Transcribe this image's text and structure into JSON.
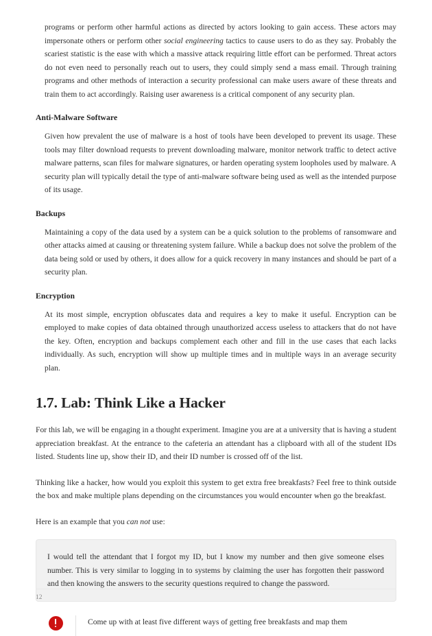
{
  "document": {
    "page_number": "12",
    "accent_color": "#cc1111",
    "callout_background": "#f1f1f1"
  },
  "paragraphs": {
    "intro_continued_a": "programs or perform other harmful actions as directed by actors looking to gain access. These actors may impersonate others or perform other ",
    "intro_continued_em": "social engineering",
    "intro_continued_b": " tactics to cause users to do as they say. Probably the scariest statistic is the ease with which a massive attack requiring little effort can be performed. Threat actors do not even need to personally reach out to users, they could simply send a mass email. Through training programs and other methods of interaction a security professional can make users aware of these threats and train them to act accordingly. Raising user awareness is a critical component of any security plan."
  },
  "subsections": [
    {
      "heading": "Anti-Malware Software",
      "body": "Given how prevalent the use of malware is a host of tools have been developed to prevent its usage. These tools may filter download requests to prevent downloading malware, monitor network traffic to detect active malware patterns, scan files for malware signatures, or harden operating system loopholes used by malware. A security plan will typically detail the type of anti-malware software being used as well as the intended purpose of its usage."
    },
    {
      "heading": "Backups",
      "body": "Maintaining a copy of the data used by a system can be a quick solution to the problems of ransomware and other attacks aimed at causing or threatening system failure. While a backup does not solve the problem of the data being sold or used by others, it does allow for a quick recovery in many instances and should be part of a security plan."
    },
    {
      "heading": "Encryption",
      "body": "At its most simple, encryption obfuscates data and requires a key to make it useful. Encryption can be employed to make copies of data obtained through unauthorized access useless to attackers that do not have the key. Often, encryption and backups complement each other and fill in the use cases that each lacks individually. As such, encryption will show up multiple times and in multiple ways in an average security plan."
    }
  ],
  "lab_section": {
    "heading": "1.7. Lab: Think Like a Hacker",
    "paragraph_1": "For this lab, we will be engaging in a thought experiment. Imagine you are at a university that is having a student appreciation breakfast. At the entrance to the cafeteria an attendant has a clipboard with all of the student IDs listed. Students line up, show their ID, and their ID number is crossed off of the list.",
    "paragraph_2": "Thinking like a hacker, how would you exploit this system to get extra free breakfasts? Feel free to think outside the box and make multiple plans depending on the circumstances you would encounter when go the breakfast.",
    "example_lead_a": "Here is an example that you ",
    "example_lead_em": "can not",
    "example_lead_b": " use:",
    "example_box": "I would tell the attendant that I forgot my ID, but I know my number and then give someone elses number. This is very similar to logging in to systems by claiming the user has forgotten their password and then knowing the answers to the security questions required to change the password.",
    "admonition": {
      "icon": "exclamation-circle-icon",
      "text": "Come up with at least five different ways of getting free breakfasts and map them"
    }
  }
}
